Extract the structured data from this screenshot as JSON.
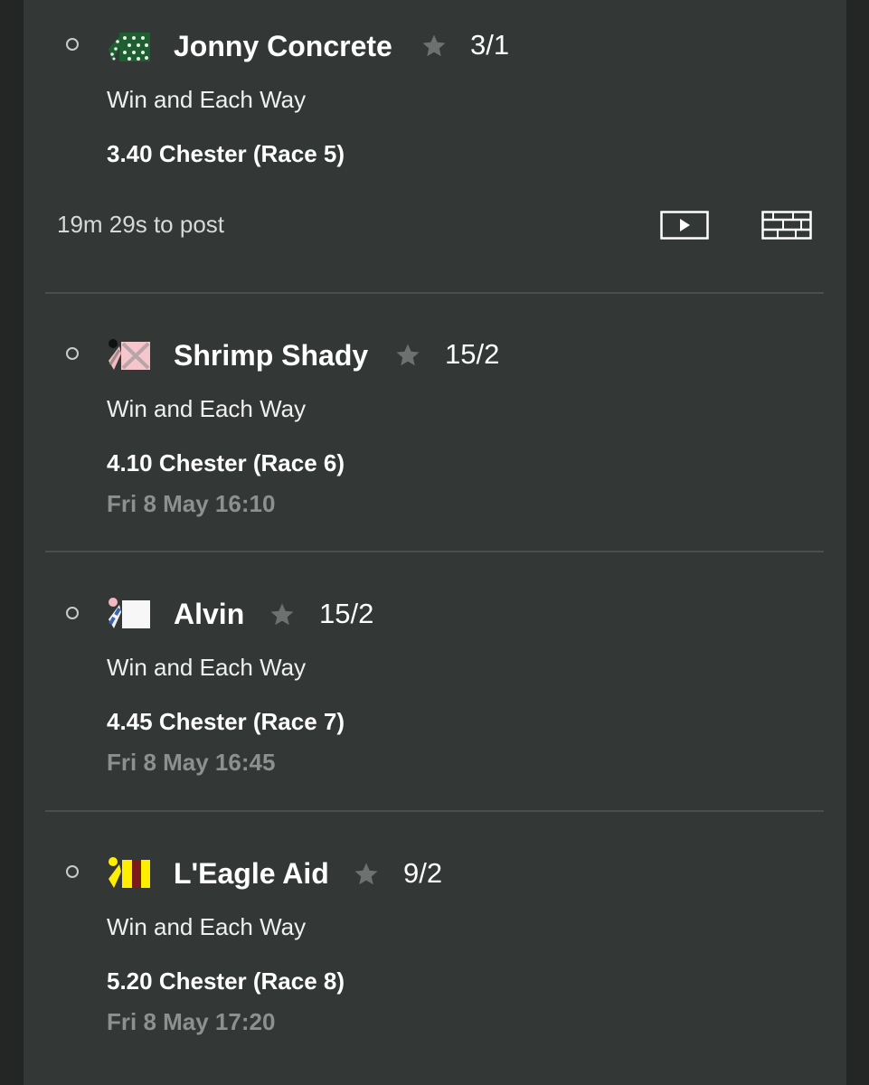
{
  "selections": [
    {
      "horse": "Jonny Concrete",
      "odds": "3/1",
      "market": "Win and Each Way",
      "race": "3.40 Chester (Race 5)",
      "countdown": "19m 29s to post",
      "silks_icon": "jockey-silks-green-white-spots-icon"
    },
    {
      "horse": "Shrimp Shady",
      "odds": "15/2",
      "market": "Win and Each Way",
      "race": "4.10 Chester (Race 6)",
      "date": "Fri 8 May 16:10",
      "silks_icon": "jockey-silks-pink-cross-icon"
    },
    {
      "horse": "Alvin",
      "odds": "15/2",
      "market": "Win and Each Way",
      "race": "4.45 Chester (Race 7)",
      "date": "Fri 8 May 16:45",
      "silks_icon": "jockey-silks-white-blue-sleeves-icon"
    },
    {
      "horse": "L'Eagle Aid",
      "odds": "9/2",
      "market": "Win and Each Way",
      "race": "5.20 Chester (Race 8)",
      "date": "Fri 8 May 17:20",
      "silks_icon": "jockey-silks-yellow-maroon-icon"
    }
  ],
  "icons": {
    "favourite": "star-icon",
    "live_stream": "play-video-icon",
    "racecard": "racecard-icon",
    "select": "radio-circle-icon"
  },
  "colors": {
    "panel_bg": "#333836",
    "page_bg": "#242625",
    "star": "#6d7170",
    "muted_text": "#8c908f"
  }
}
